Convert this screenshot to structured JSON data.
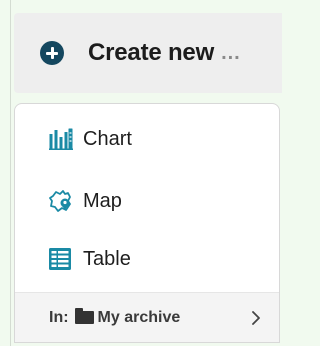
{
  "create_button": {
    "label": "Create new",
    "ellipsis": "...",
    "icon": "plus-circle-icon"
  },
  "menu": {
    "items": [
      {
        "label": "Chart",
        "icon": "chart-icon"
      },
      {
        "label": "Map",
        "icon": "map-icon"
      },
      {
        "label": "Table",
        "icon": "table-icon"
      }
    ],
    "footer": {
      "prefix": "In:",
      "folder_icon": "folder-icon",
      "folder_name": "My archive",
      "chevron_icon": "chevron-right-icon"
    }
  },
  "colors": {
    "accent": "#1a8aa5",
    "plus_icon": "#14475f",
    "background": "#f1faef"
  }
}
